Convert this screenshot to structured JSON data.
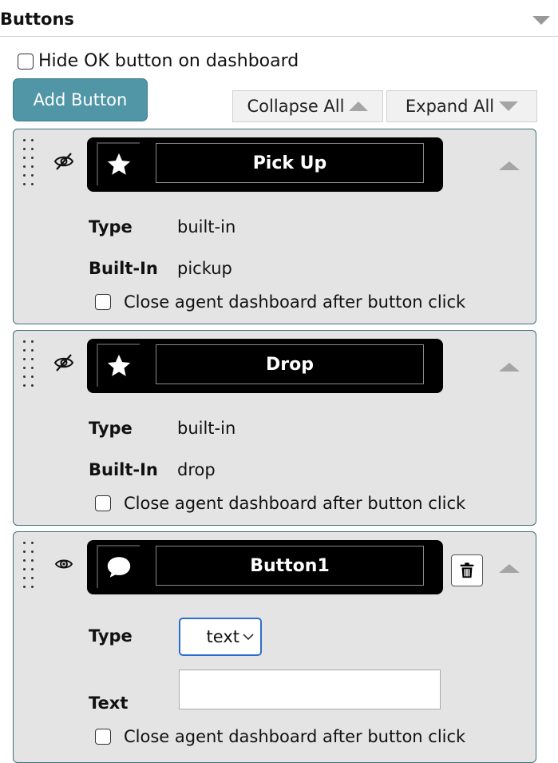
{
  "section": {
    "title": "Buttons"
  },
  "hide_ok": {
    "label": "Hide OK button on dashboard"
  },
  "toolbar": {
    "add_label": "Add Button",
    "collapse_label": "Collapse All",
    "expand_label": "Expand All"
  },
  "cards": [
    {
      "title": "Pick Up",
      "icon": "star-icon",
      "visibility_icon": "eye-off-icon",
      "fields": {
        "type_label": "Type",
        "type_value": "built-in",
        "builtin_label": "Built-In",
        "builtin_value": "pickup"
      },
      "close_label": "Close agent dashboard after button click"
    },
    {
      "title": "Drop",
      "icon": "star-icon",
      "visibility_icon": "eye-off-icon",
      "fields": {
        "type_label": "Type",
        "type_value": "built-in",
        "builtin_label": "Built-In",
        "builtin_value": "drop"
      },
      "close_label": "Close agent dashboard after button click"
    },
    {
      "title": "Button1",
      "icon": "speech-bubble-icon",
      "visibility_icon": "eye-icon",
      "fields": {
        "type_label": "Type",
        "type_value": "text",
        "text_label": "Text",
        "text_value": ""
      },
      "close_label": "Close agent dashboard after button click"
    }
  ],
  "colors": {
    "accent": "#5096a6",
    "card_border": "#406f76",
    "card_bg": "#e4e4e4",
    "select_focus": "#2a6fcf"
  }
}
